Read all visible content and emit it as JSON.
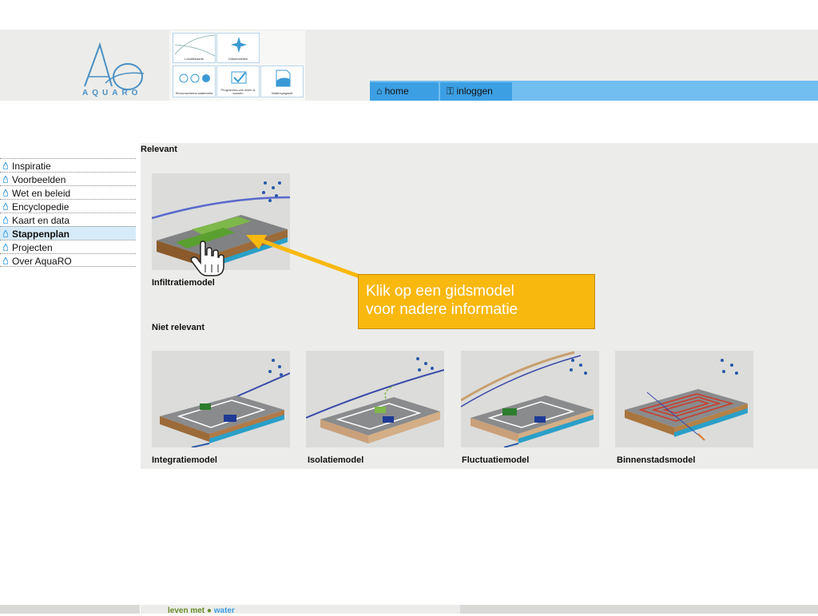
{
  "header": {
    "logo_text": "AQUARO",
    "tiles": [
      {
        "label": "Locatiekaarts"
      },
      {
        "label": "Gidsmodellen"
      },
      {
        "label": "Stroomschema watertoets"
      },
      {
        "label": "Programma van eisen & kansen"
      },
      {
        "label": "Watersysgraaf"
      }
    ],
    "nav": [
      {
        "label": "home",
        "icon": "home-icon"
      },
      {
        "label": "inloggen",
        "icon": "key-icon"
      }
    ]
  },
  "sidebar": {
    "items": [
      {
        "label": "Inspiratie",
        "active": false
      },
      {
        "label": "Voorbeelden",
        "active": false
      },
      {
        "label": "Wet en beleid",
        "active": false
      },
      {
        "label": "Encyclopedie",
        "active": false
      },
      {
        "label": "Kaart en data",
        "active": false
      },
      {
        "label": "Stappenplan",
        "active": true
      },
      {
        "label": "Projecten",
        "active": false
      },
      {
        "label": "Over AquaRO",
        "active": false
      }
    ]
  },
  "main": {
    "relevant_title": "Relevant",
    "relevant_models": [
      {
        "label": "Infiltratiemodel"
      }
    ],
    "niet_relevant_title": "Niet relevant",
    "niet_relevant_models": [
      {
        "label": "Integratiemodel"
      },
      {
        "label": "Isolatiemodel"
      },
      {
        "label": "Fluctuatiemodel"
      },
      {
        "label": "Binnenstadsmodel"
      }
    ]
  },
  "callout": {
    "line1": "Klik op een gidsmodel",
    "line2": "voor nadere informatie"
  },
  "footer": {
    "part1": "leven met ",
    "part2": "water"
  },
  "colors": {
    "accent_blue": "#3c9fe3",
    "nav_bar": "#72bef0",
    "callout": "#f9b80e",
    "panel_bg": "#ecedea"
  }
}
